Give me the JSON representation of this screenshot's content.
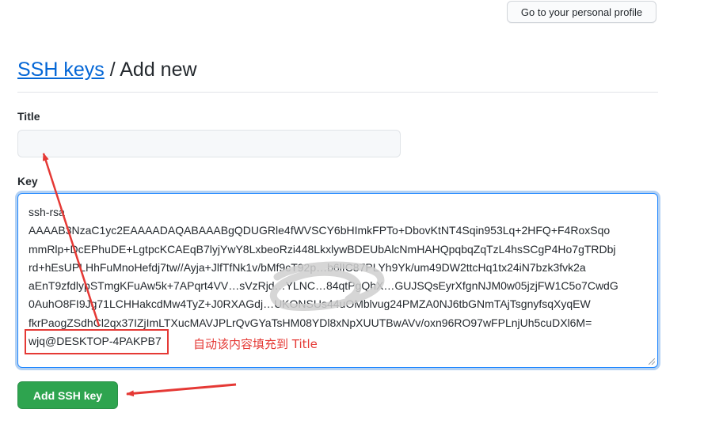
{
  "header": {
    "profile_button": "Go to your personal profile"
  },
  "page": {
    "breadcrumb_link": "SSH keys",
    "separator": " / ",
    "heading_current": "Add new"
  },
  "form": {
    "title_label": "Title",
    "title_value": "",
    "key_label": "Key",
    "key_lines": [
      "ssh-rsa",
      "AAAAB3NzaC1yc2EAAAADAQABAAABgQDUGRle4fWVSCY6bHImkFPTo+DbovKtNT4Sqin953Lq+2HFQ+F4RoxSqo",
      "mmRlp+DcEPhuDE+LgtpcKCAEqB7lyjYwY8LxbeoRzi448LkxlywBDEUbAlcNmHAHQpqbqZqTzL4hsSCgP4Ho7gTRDbj",
      "rd+hEsUPLHhFuMnoHefdj7tw//Ayja+JlfTfNk1v/bMf9cT92p…b6lIC87PLYh9Yk/um49DW2ttcHq1tx24iN7bzk3fvk2a",
      "aEnT9zfdlypSTmgKFuAw5k+7APqrt4VV…sVzRjd…YLNC…84qtPgQhX…GUJSQsEyrXfgnNJM0w05jzjFW1C5o7CwdG",
      "0AuhO8FI9Jg71LCHHakcdMw4TyZ+J0RXAGdj…UKONSUs44uOMblvug24PMZA0NJ6tbGNmTAjTsgnyfsqXyqEW",
      "fkrPaogZSdhCl2qx37IZjImLTXucMAVJPLrQvGYaTsHM08YDl8xNpXUUTBwAVv/oxn96RO97wFPLnjUh5cuDXl6M=",
      "wjq@DESKTOP-4PAKPB7"
    ],
    "submit_label": "Add SSH key"
  },
  "annotation": {
    "text": "自动该内容填充到 Title",
    "color": "#e53935"
  },
  "colors": {
    "link": "#0366d6",
    "primary_button": "#2ea44f",
    "focus_border": "#2188ff"
  }
}
